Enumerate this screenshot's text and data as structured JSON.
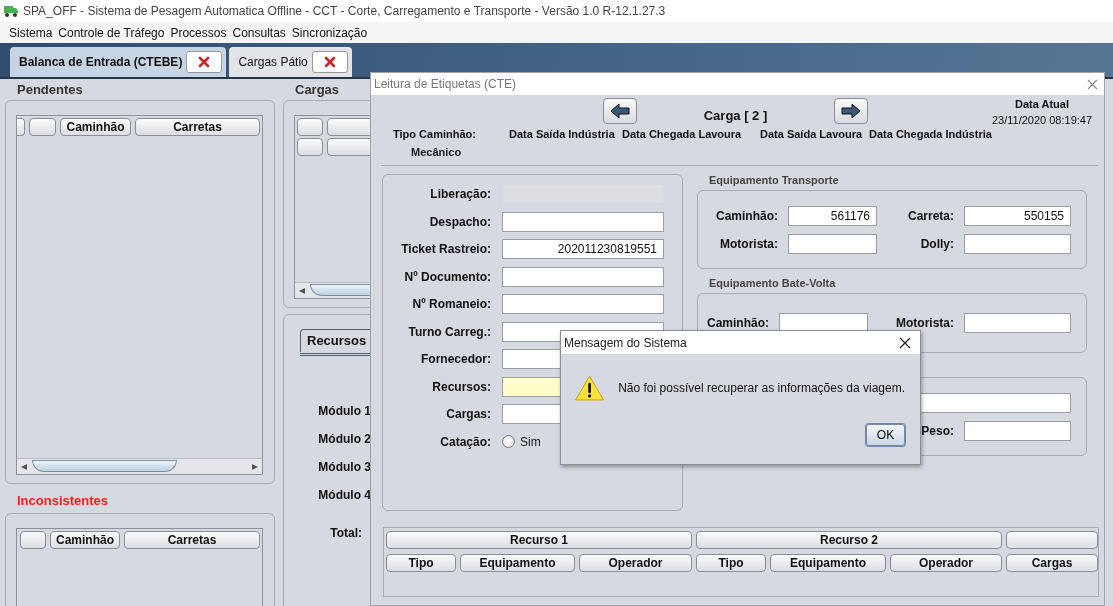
{
  "app": {
    "title": "SPA_OFF - Sistema de Pesagem Automatica Offline - CCT - Corte, Carregamento e Transporte - Versão 1.0 R-12.1.27.3"
  },
  "menu": [
    "Sistema",
    "Controle de Tráfego",
    "Processos",
    "Consultas",
    "Sincronização"
  ],
  "tabs": [
    {
      "label": "Balanca de Entrada (CTEBE)",
      "selected": true
    },
    {
      "label": "Cargas Pátio",
      "selected": false
    }
  ],
  "pendentes": {
    "title": "Pendentes",
    "columns": [
      {
        "kind": "partial"
      },
      {
        "kind": "blank"
      },
      {
        "kind": "label",
        "label": "Caminhão"
      },
      {
        "kind": "label",
        "label": "Carretas"
      }
    ]
  },
  "inconsistentes": {
    "title": "Inconsistentes",
    "columns": [
      {
        "kind": "blank"
      },
      {
        "kind": "label",
        "label": "Caminhão"
      },
      {
        "kind": "label",
        "label": "Carretas"
      }
    ]
  },
  "cargas": {
    "title": "Cargas",
    "header_rows": [
      [
        {
          "kind": "blank"
        },
        {
          "kind": "blank"
        }
      ],
      [
        {
          "kind": "blank"
        },
        {
          "kind": "blank"
        }
      ]
    ]
  },
  "recursos": {
    "tab": {
      "label": "Recursos",
      "selected": true
    },
    "modules": [
      "Módulo 1",
      "Módulo 2",
      "Módulo 3",
      "Módulo 4"
    ],
    "total_label": "Total:"
  },
  "frame": {
    "title": "Leitura de Etiquetas (CTE)",
    "carga": "Carga [ 2 ]",
    "data_atual_label": "Data Atual",
    "data_atual": "23/11/2020 08:19:47",
    "info_labels": [
      "Tipo Caminhão:",
      "Data Saída Indústria",
      "Data Chegada Lavoura",
      "Data Saída Lavoura",
      "Data Chegada Indústria"
    ],
    "tipo_caminhao": "Mecânico",
    "form": [
      {
        "label": "Liberação:",
        "kind": "field",
        "disabled": true,
        "highlighted": false
      },
      {
        "label": "Despacho:",
        "kind": "field",
        "disabled": false,
        "highlighted": false
      },
      {
        "label": "Ticket Rastreio:",
        "kind": "field",
        "value": "202011230819551",
        "disabled": false,
        "highlighted": false
      },
      {
        "label": "Nº Documento:",
        "kind": "field",
        "disabled": false,
        "highlighted": false
      },
      {
        "label": "Nº Romaneio:",
        "kind": "field",
        "disabled": false,
        "highlighted": false
      },
      {
        "label": "Turno Carreg.:",
        "kind": "field",
        "disabled": false,
        "highlighted": false
      },
      {
        "label": "Fornecedor:",
        "kind": "field",
        "disabled": false,
        "highlighted": false
      },
      {
        "label": "Recursos:",
        "kind": "field",
        "disabled": false,
        "highlighted": true
      },
      {
        "label": "Cargas:",
        "kind": "field",
        "disabled": false,
        "highlighted": false
      },
      {
        "label": "Catação:",
        "kind": "radio",
        "option": "Sim",
        "selected": false
      }
    ],
    "transporte": {
      "title": "Equipamento Transporte",
      "fields": [
        {
          "label": "Caminhão:",
          "value": "561176"
        },
        {
          "label": "Carreta:",
          "value": "550155"
        },
        {
          "label": "Motorista:"
        },
        {
          "label": "Dolly:"
        }
      ]
    },
    "bate_volta": {
      "title": "Equipamento Bate-Volta",
      "fields": [
        {
          "label": "Caminhão:"
        },
        {
          "label": "Motorista:"
        }
      ]
    },
    "panel_3": {
      "fields": [
        {
          "kind": "wide"
        },
        {
          "kind": "labeled",
          "label": "Peso:"
        }
      ]
    },
    "table": {
      "groups": [
        {
          "kind": "group",
          "label": "Recurso 1"
        },
        {
          "kind": "group",
          "label": "Recurso 2"
        },
        {
          "kind": "blank"
        }
      ],
      "columns": [
        "Tipo",
        "Equipamento",
        "Operador",
        "Tipo",
        "Equipamento",
        "Operador",
        "Cargas"
      ]
    }
  },
  "dialog": {
    "title": "Mensagem do Sistema",
    "message": "Não foi possível recuperar as informações da viagem.",
    "buttons": [
      {
        "label": "OK",
        "focused": true
      }
    ]
  }
}
